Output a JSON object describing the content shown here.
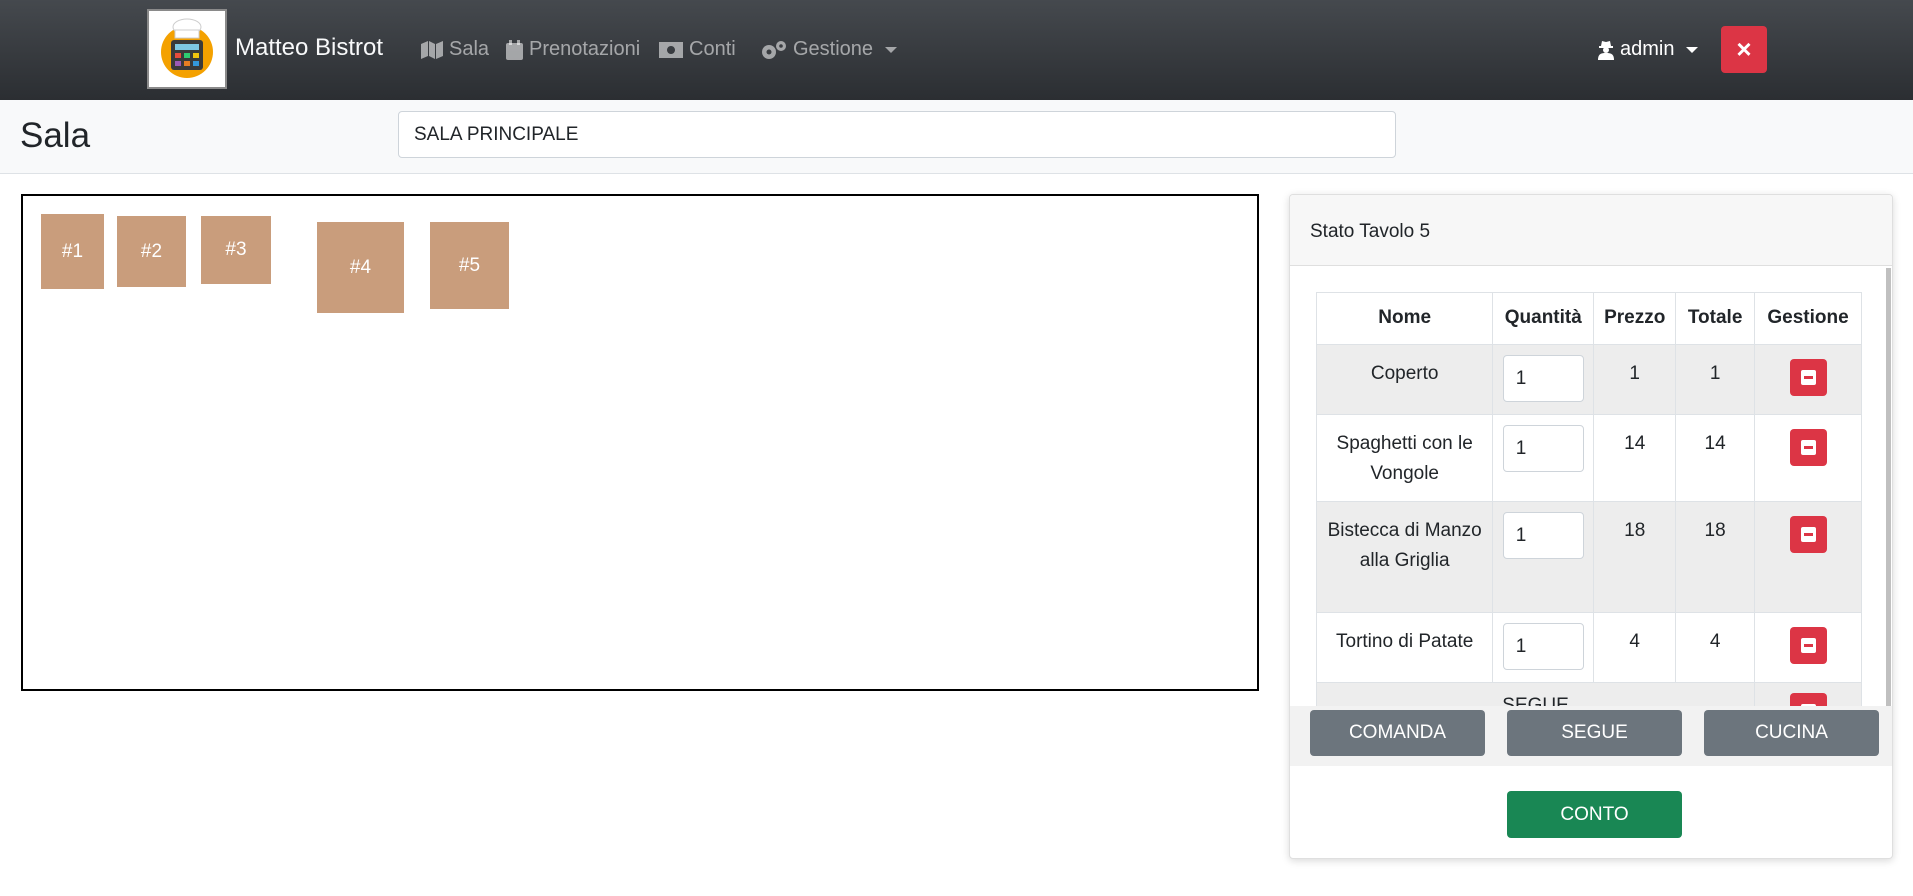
{
  "navbar": {
    "brand": "Matteo Bistrot",
    "logo_icon": "chef-cash-register-icon",
    "items": [
      {
        "label": "Sala",
        "icon": "map-icon"
      },
      {
        "label": "Prenotazioni",
        "icon": "calendar-icon"
      },
      {
        "label": "Conti",
        "icon": "money-bill-icon"
      },
      {
        "label": "Gestione",
        "icon": "gears-icon"
      }
    ],
    "user": {
      "label": "admin",
      "icon": "user-secret-icon"
    },
    "close_label": "×"
  },
  "header": {
    "title": "Sala",
    "room_select": "SALA PRINCIPALE"
  },
  "floor": {
    "tables": [
      "#1",
      "#2",
      "#3",
      "#4",
      "#5"
    ]
  },
  "status_card": {
    "title": "Stato Tavolo 5",
    "columns": [
      "Nome",
      "Quantità",
      "Prezzo",
      "Totale",
      "Gestione"
    ],
    "rows": [
      {
        "name": "Coperto",
        "qty": "1",
        "price": "1",
        "total": "1"
      },
      {
        "name": "Spaghetti con le Vongole",
        "qty": "1",
        "price": "14",
        "total": "14"
      },
      {
        "name": "Bistecca di Manzo alla Griglia",
        "qty": "1",
        "price": "18",
        "total": "18"
      },
      {
        "name": "Tortino di Patate",
        "qty": "1",
        "price": "4",
        "total": "4"
      }
    ],
    "separator_label": "SEGUE",
    "buttons": {
      "comanda": "COMANDA",
      "segue": "SEGUE",
      "cucina": "CUCINA",
      "conto": "CONTO"
    }
  },
  "colors": {
    "table_tile": "#c99d7c",
    "danger": "#dc3545",
    "secondary": "#6c757d",
    "success": "#198754"
  }
}
